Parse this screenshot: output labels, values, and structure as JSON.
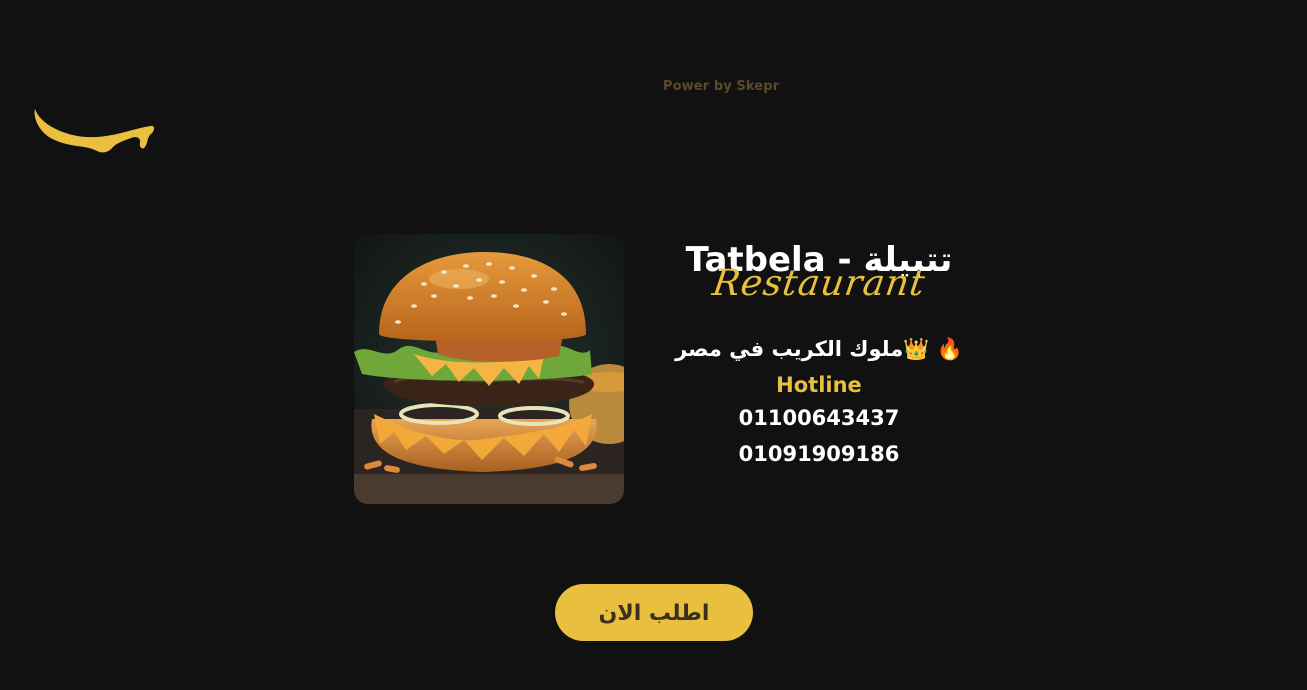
{
  "header": {
    "powered_by": "Power by Skepr"
  },
  "brand": {
    "logo_icon": "yellow-sauce-drip-logo",
    "title": "Tatbela - تتبيلة",
    "subtitle": "Restaurant"
  },
  "hero": {
    "image_icon": "burger-photo"
  },
  "info": {
    "slogan": "🔥 👑ملوك الكريب في مصر",
    "hotline_label": "Hotline",
    "phones": [
      "01100643437",
      "01091909186"
    ]
  },
  "cta": {
    "order_label": "اطلب الان"
  },
  "colors": {
    "background": "#111111",
    "accent": "#e8bf3e",
    "text": "#ffffff",
    "button_text": "#3b2f1e"
  }
}
